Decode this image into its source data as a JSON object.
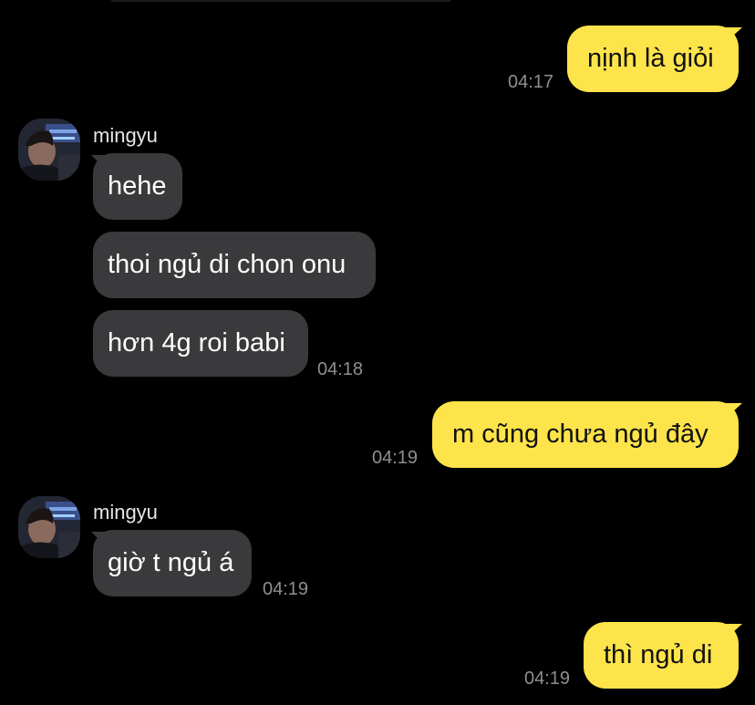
{
  "chat": {
    "messages": [
      {
        "id": "m1",
        "from": "me",
        "text": "nịnh là giỏi",
        "time": "04:17"
      },
      {
        "id": "m2",
        "from": "mingyu",
        "sender": "mingyu",
        "text": "hehe"
      },
      {
        "id": "m3",
        "from": "mingyu",
        "text": "thoi ngủ di chon onu"
      },
      {
        "id": "m4",
        "from": "mingyu",
        "text": "hơn 4g roi babi",
        "time": "04:18"
      },
      {
        "id": "m5",
        "from": "me",
        "text": "m cũng chưa ngủ đây",
        "time": "04:19"
      },
      {
        "id": "m6",
        "from": "mingyu",
        "sender": "mingyu",
        "text": "giờ t ngủ á",
        "time": "04:19"
      },
      {
        "id": "m7",
        "from": "me",
        "text": "thì ngủ di",
        "time": "04:19"
      }
    ]
  },
  "colors": {
    "background": "#000000",
    "outgoing_bubble": "#fde44a",
    "incoming_bubble": "#3a3a3c",
    "timestamp": "#8e8e93"
  },
  "icons": {
    "avatar": "profile-photo"
  }
}
